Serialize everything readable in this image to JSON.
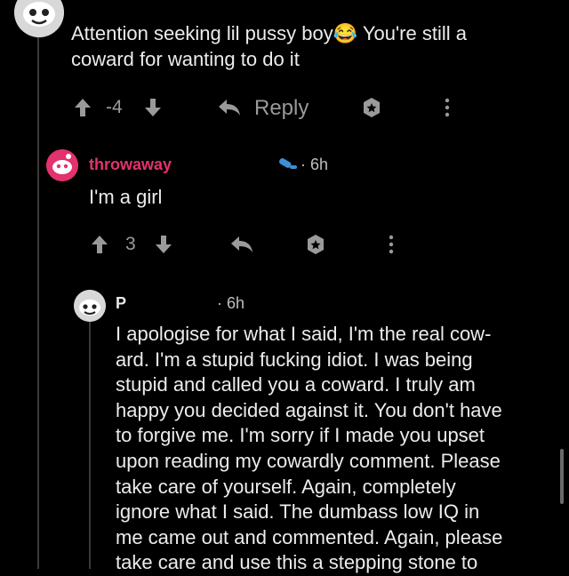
{
  "comments": [
    {
      "text": "Attention seeking lil pussy boy😂 You're still a\ncoward for wanting to do it",
      "score": "-4",
      "reply_label": "Reply"
    },
    {
      "username": "throwaway",
      "age": "· 6h",
      "text": "I'm a girl",
      "score": "3"
    },
    {
      "username": "P",
      "age": "· 6h",
      "text": "I apologise for what I said, I'm the real cow-\nard. I'm a stupid fucking idiot. I was being\nstupid and called you a coward. I truly am\nhappy you decided against it. You don't have\nto forgive me. I'm sorry if I made you upset\nupon reading my cowardly comment. Please\ntake care of yourself. Again, completely\nignore what I said. The dumbass low IQ in\nme came out and commented. Again, please\ntake care and use this a stepping stone to"
    }
  ],
  "colors": {
    "background": "#000000",
    "op_username": "#e3326d",
    "icon_gray": "#9a9a9a"
  }
}
